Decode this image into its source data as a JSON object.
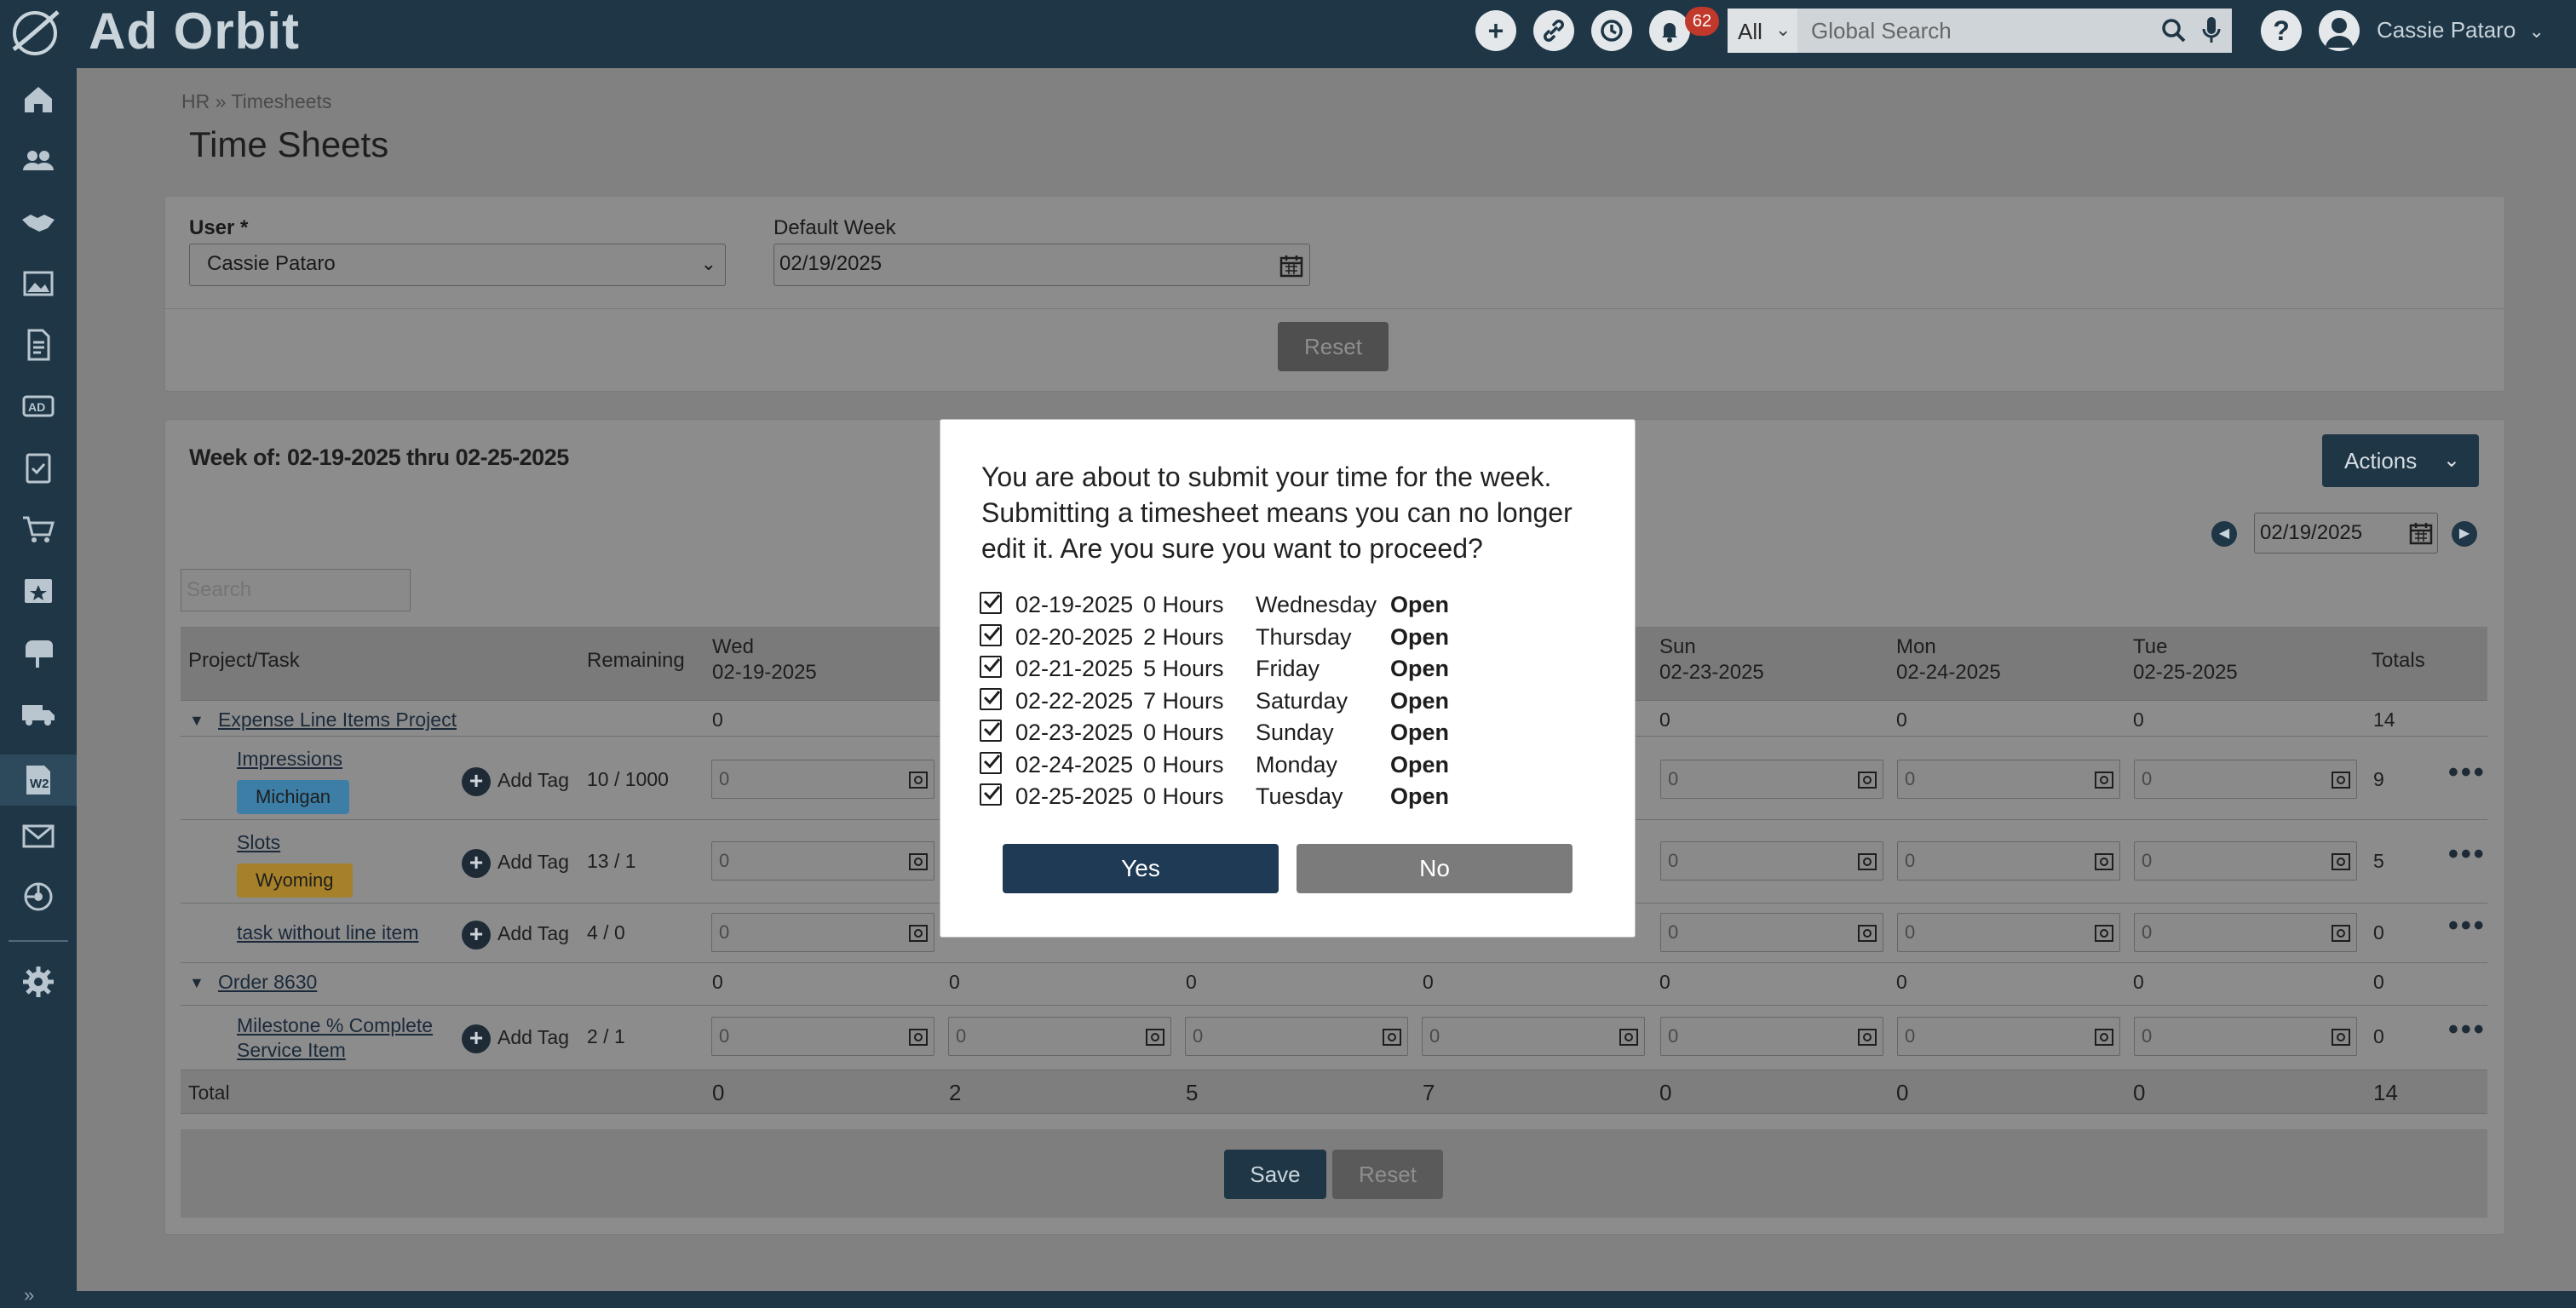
{
  "app": {
    "logo_text": "Ad Orbit"
  },
  "topbar": {
    "notification_count": "62",
    "search_scope": "All",
    "search_placeholder": "Global Search",
    "user_name": "Cassie Pataro"
  },
  "sidebar": {
    "icons": [
      "home-icon",
      "users-icon",
      "handshake-icon",
      "image-icon",
      "document-icon",
      "ad-icon",
      "clipboard-check-icon",
      "cart-icon",
      "calendar-star-icon",
      "mailbox-icon",
      "truck-icon",
      "timesheet-icon",
      "mail-icon",
      "support-icon",
      "settings-icon"
    ]
  },
  "breadcrumb": {
    "root": "HR",
    "sep": "»",
    "current": "Timesheets"
  },
  "page": {
    "title": "Time Sheets"
  },
  "filters": {
    "user_label": "User *",
    "user_value": "Cassie Pataro",
    "week_label": "Default Week",
    "week_value": "02/19/2025",
    "reset_label": "Reset"
  },
  "week": {
    "heading": "Week of: 02-19-2025 thru 02-25-2025",
    "actions_label": "Actions",
    "nav_date": "02/19/2025",
    "search_placeholder": "Search"
  },
  "table": {
    "headers": {
      "project": "Project/Task",
      "remaining": "Remaining",
      "totals": "Totals"
    },
    "days": [
      {
        "day": "Wed",
        "date": "02-19-2025"
      },
      {
        "day": "Sun",
        "date": "02-23-2025"
      },
      {
        "day": "Mon",
        "date": "02-24-2025"
      },
      {
        "day": "Tue",
        "date": "02-25-2025"
      }
    ],
    "groups": [
      {
        "name": "Expense Line Items Project",
        "values": [
          "0",
          "0",
          "0",
          "0",
          "14"
        ]
      },
      {
        "name": "Order 8630",
        "values": [
          "0",
          "0",
          "0",
          "0",
          "0",
          "0",
          "0",
          "0"
        ]
      }
    ],
    "tasks": [
      {
        "name": "Impressions",
        "tag": "Michigan",
        "add_tag": "Add Tag",
        "remaining": "10 / 1000",
        "total": "9"
      },
      {
        "name": "Slots",
        "tag": "Wyoming",
        "add_tag": "Add Tag",
        "remaining": "13 / 1",
        "total": "5"
      },
      {
        "name": "task without line item",
        "add_tag": "Add Tag",
        "remaining": "4 / 0",
        "total": "0"
      },
      {
        "name": "Milestone % Complete Service Item",
        "add_tag": "Add Tag",
        "remaining": "2 / 1",
        "total": "0"
      }
    ],
    "cell_placeholder": "0",
    "total_label": "Total",
    "total_values": [
      "0",
      "2",
      "5",
      "7",
      "0",
      "0",
      "0",
      "14"
    ]
  },
  "footer": {
    "save_label": "Save",
    "reset_label": "Reset"
  },
  "modal": {
    "message": "You are about to submit your time for the week. Submitting a timesheet means you can no longer edit it. Are you sure you want to proceed?",
    "rows": [
      {
        "date": "02-19-2025",
        "hours": "0 Hours",
        "day": "Wednesday",
        "status": "Open"
      },
      {
        "date": "02-20-2025",
        "hours": "2 Hours",
        "day": "Thursday",
        "status": "Open"
      },
      {
        "date": "02-21-2025",
        "hours": "5 Hours",
        "day": "Friday",
        "status": "Open"
      },
      {
        "date": "02-22-2025",
        "hours": "7 Hours",
        "day": "Saturday",
        "status": "Open"
      },
      {
        "date": "02-23-2025",
        "hours": "0 Hours",
        "day": "Sunday",
        "status": "Open"
      },
      {
        "date": "02-24-2025",
        "hours": "0 Hours",
        "day": "Monday",
        "status": "Open"
      },
      {
        "date": "02-25-2025",
        "hours": "0 Hours",
        "day": "Tuesday",
        "status": "Open"
      }
    ],
    "yes_label": "Yes",
    "no_label": "No"
  },
  "colors": {
    "navbar": "#1e3646",
    "primary_button": "#1e3a55",
    "tag_michigan": "#3d7ea6",
    "tag_wyoming": "#a6812a",
    "badge": "#c0392b"
  }
}
